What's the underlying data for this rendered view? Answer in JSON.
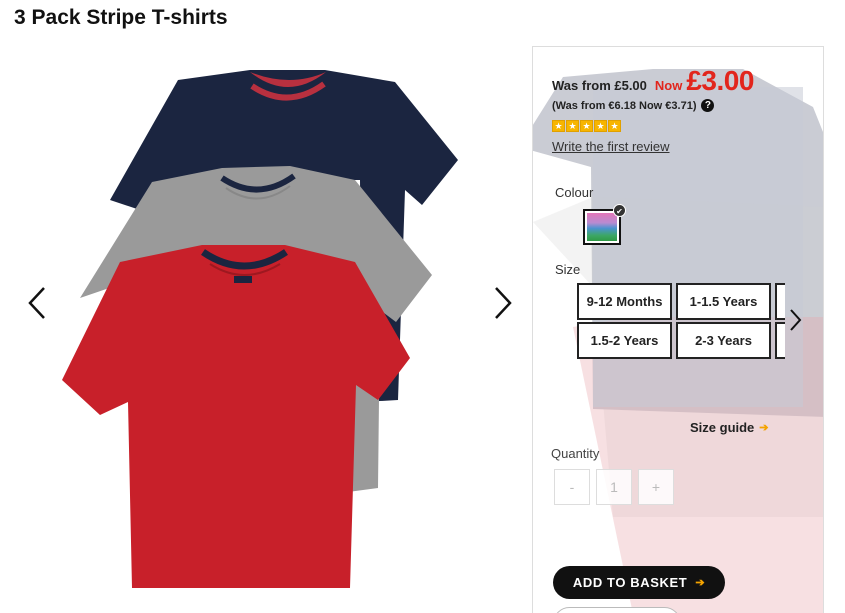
{
  "product": {
    "title": "3 Pack Stripe T-shirts"
  },
  "gallery": {
    "prev_icon": "chevron-left-icon",
    "next_icon": "chevron-right-icon"
  },
  "price": {
    "was": "Was from £5.00",
    "now_label": "Now",
    "now_price": "£3.00",
    "euro": "(Was from €6.18 Now €3.71)",
    "help_glyph": "?"
  },
  "reviews": {
    "rating": 5,
    "link": "Write the first review"
  },
  "colour": {
    "label": "Colour",
    "selected_swatch": "multicolour"
  },
  "size": {
    "label": "Size",
    "options": [
      "9-12 Months",
      "1-1.5 Years",
      "1.5-2 Years",
      "2-3 Years"
    ],
    "guide": "Size guide"
  },
  "quantity": {
    "label": "Quantity",
    "minus": "-",
    "value": "1",
    "plus": "+"
  },
  "actions": {
    "add_to_basket": "ADD TO BASKET"
  },
  "colors": {
    "accent_red": "#e2251c",
    "accent_orange": "#f4a300",
    "navy": "#1b2540",
    "grey": "#9a9a9a",
    "red_shirt": "#c8202a"
  }
}
